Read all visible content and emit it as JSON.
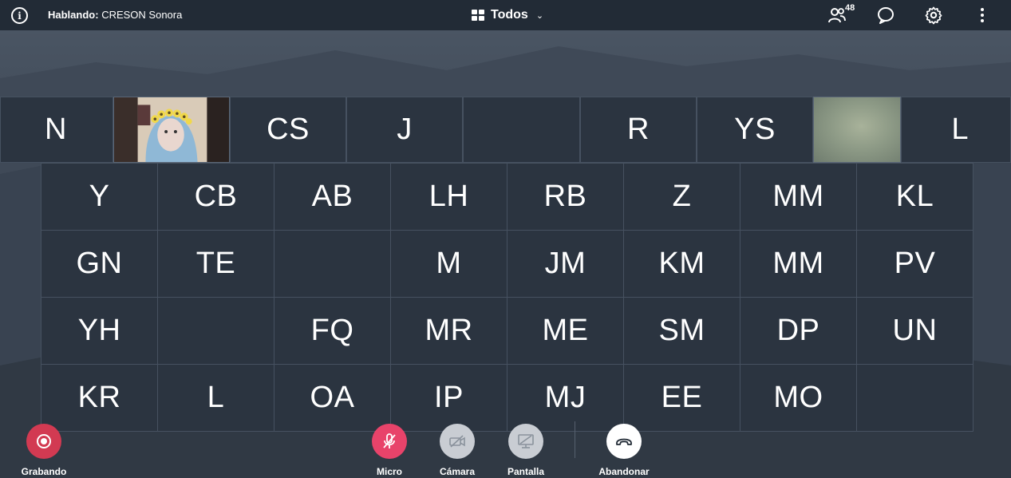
{
  "topbar": {
    "speaking_prefix": "Hablando:",
    "speaking_name": "CRESON Sonora",
    "layout_label": "Todos",
    "participant_count": "48"
  },
  "participants_top_row": [
    "N",
    "",
    "CS",
    "J",
    "",
    "R",
    "YS",
    "",
    "L"
  ],
  "participants_grid": [
    [
      "Y",
      "CB",
      "AB",
      "LH",
      "RB",
      "Z",
      "MM",
      "KL"
    ],
    [
      "GN",
      "TE",
      "",
      "M",
      "JM",
      "KM",
      "MM",
      "PV"
    ],
    [
      "YH",
      "",
      "FQ",
      "MR",
      "ME",
      "SM",
      "DP",
      "UN"
    ],
    [
      "KR",
      "L",
      "OA",
      "IP",
      "MJ",
      "EE",
      "MO",
      ""
    ]
  ],
  "controls": {
    "record_label": "Grabando",
    "mic_label": "Micro",
    "camera_label": "Cámara",
    "screen_label": "Pantalla",
    "leave_label": "Abandonar"
  },
  "colors": {
    "topbar": "#222b36",
    "tile": "#2b3440",
    "mic_active": "#e8436a",
    "record": "#d23a52",
    "disabled_btn": "#c9cdd3",
    "leave": "#ffffff"
  },
  "icons": {
    "info": "info-icon",
    "layout": "grid-icon",
    "users": "users-icon",
    "chat": "chat-icon",
    "settings": "gear-icon",
    "more": "more-vertical-icon",
    "record": "record-icon",
    "mic": "mic-off-icon",
    "camera": "camera-off-icon",
    "screen": "screen-share-off-icon",
    "leave": "hangup-icon"
  }
}
